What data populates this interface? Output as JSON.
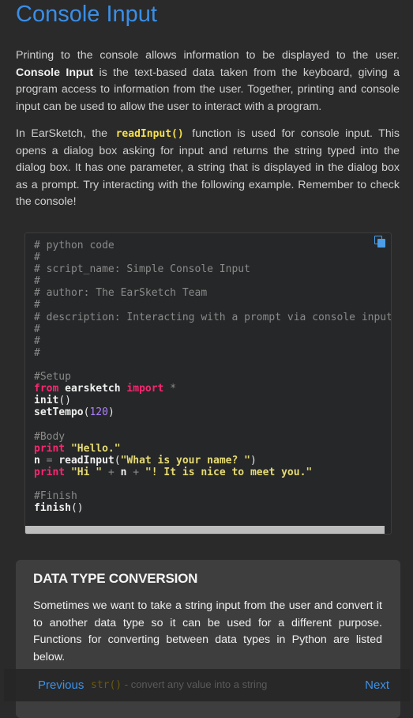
{
  "page": {
    "title": "Console Input"
  },
  "intro": {
    "p1_a": "Printing to the console allows information to be displayed to the user. ",
    "p1_bold": "Console Input",
    "p1_b": " is the text-based data taken from the keyboard, giving a program access to information from the user. Together, printing and console input can be used to allow the user to interact with a program.",
    "p2_a": "In EarSketch, the ",
    "p2_code": "readInput()",
    "p2_b": " function is used for console input. This opens a dialog box asking for input and returns the string typed into the dialog box. It has one parameter, a string that is displayed in the dialog box as a prompt. Try interacting with the following example. Remember to check the console!"
  },
  "code": {
    "copy_icon": "copy-icon",
    "lines": [
      "# python code",
      "#",
      "# script_name: Simple Console Input",
      "#",
      "# author: The EarSketch Team",
      "#",
      "# description: Interacting with a prompt via console input",
      "#",
      "#",
      "#",
      "",
      "#Setup",
      "from earsketch import *",
      "init()",
      "setTempo(120)",
      "",
      "#Body",
      "print \"Hello.\"",
      "n = readInput(\"What is your name? \")",
      "print \"Hi \" + n + \"! It is nice to meet you.\"",
      "",
      "#Finish",
      "finish()"
    ]
  },
  "card": {
    "heading": "DATA TYPE CONVERSION",
    "text": "Sometimes we want to take a string input from the user and convert it to another data type so it can be used for a different purpose. Functions for converting between data types in Python are listed below."
  },
  "footer": {
    "prev_label": "Previous",
    "next_label": "Next",
    "behind_code": "str()",
    "behind_text": " - convert any value into a string"
  },
  "colors": {
    "title": "#3a8ee6",
    "keyword": "#f92672",
    "string": "#e6db74",
    "number": "#ae81ff",
    "comment": "#8a8a8a",
    "inline_code": "#f6e04b"
  }
}
